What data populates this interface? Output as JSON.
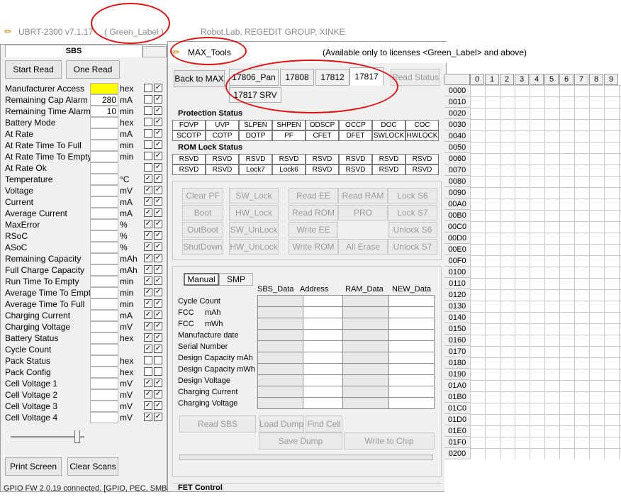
{
  "app": {
    "title": "UBRT-2300 v7.1.17",
    "label": "( Green_Label )",
    "org": "Robot.Lab,  REGEDIT GROUP,  XINKE"
  },
  "sbs": {
    "tab_label": "SBS",
    "start_read": "Start Read",
    "one_read": "One Read",
    "rows": [
      {
        "label": "Manufacturer Access",
        "value": "",
        "unit": "hex",
        "c1": "",
        "c2": "✓",
        "yellow": true
      },
      {
        "label": "Remaining Cap Alarm",
        "value": "280",
        "unit": "mA",
        "c1": "",
        "c2": "✓"
      },
      {
        "label": "Remaining Time Alarm",
        "value": "10",
        "unit": "min",
        "c1": "",
        "c2": "✓"
      },
      {
        "label": "Battery Mode",
        "value": "",
        "unit": "hex",
        "c1": "",
        "c2": "✓"
      },
      {
        "label": "At Rate",
        "value": "",
        "unit": "mA",
        "c1": "",
        "c2": "✓"
      },
      {
        "label": "At Rate Time To Full",
        "value": "",
        "unit": "min",
        "c1": "",
        "c2": "✓"
      },
      {
        "label": "At Rate Time To Empty",
        "value": "",
        "unit": "min",
        "c1": "",
        "c2": "✓"
      },
      {
        "label": "At Rate Ok",
        "value": "",
        "unit": "",
        "c1": "",
        "c2": "✓"
      },
      {
        "label": "Temperature",
        "value": "",
        "unit": "°C",
        "c1": "✓",
        "c2": "✓"
      },
      {
        "label": "Voltage",
        "value": "",
        "unit": "mV",
        "c1": "✓",
        "c2": "✓"
      },
      {
        "label": "Current",
        "value": "",
        "unit": "mA",
        "c1": "✓",
        "c2": "✓"
      },
      {
        "label": "Average Current",
        "value": "",
        "unit": "mA",
        "c1": "✓",
        "c2": "✓"
      },
      {
        "label": "MaxError",
        "value": "",
        "unit": "%",
        "c1": "✓",
        "c2": "✓"
      },
      {
        "label": "RSoC",
        "value": "",
        "unit": "%",
        "c1": "✓",
        "c2": "✓"
      },
      {
        "label": "ASoC",
        "value": "",
        "unit": "%",
        "c1": "✓",
        "c2": "✓"
      },
      {
        "label": "Remaining Capacity",
        "value": "",
        "unit": "mAh",
        "c1": "✓",
        "c2": "✓"
      },
      {
        "label": "Full Charge Capacity",
        "value": "",
        "unit": "mAh",
        "c1": "✓",
        "c2": "✓"
      },
      {
        "label": "Run Time To Empty",
        "value": "",
        "unit": "min",
        "c1": "✓",
        "c2": "✓"
      },
      {
        "label": "Average Time To Empty",
        "value": "",
        "unit": "min",
        "c1": "✓",
        "c2": "✓"
      },
      {
        "label": "Average Time To Full",
        "value": "",
        "unit": "min",
        "c1": "✓",
        "c2": "✓"
      },
      {
        "label": "Charging Current",
        "value": "",
        "unit": "mA",
        "c1": "✓",
        "c2": "✓"
      },
      {
        "label": "Charging Voltage",
        "value": "",
        "unit": "mV",
        "c1": "✓",
        "c2": "✓"
      },
      {
        "label": "Battery Status",
        "value": "",
        "unit": "hex",
        "c1": "✓",
        "c2": "✓"
      },
      {
        "label": "Cycle Count",
        "value": "",
        "unit": "",
        "c1": "✓",
        "c2": "✓"
      },
      {
        "label": "Pack Status",
        "value": "",
        "unit": "hex",
        "c1": "",
        "c2": ""
      },
      {
        "label": "Pack Config",
        "value": "",
        "unit": "hex",
        "c1": "",
        "c2": ""
      },
      {
        "label": "Cell Voltage 1",
        "value": "",
        "unit": "mV",
        "c1": "✓",
        "c2": "✓"
      },
      {
        "label": "Cell Voltage 2",
        "value": "",
        "unit": "mV",
        "c1": "✓",
        "c2": "✓"
      },
      {
        "label": "Cell Voltage 3",
        "value": "",
        "unit": "mV",
        "c1": "✓",
        "c2": "✓"
      },
      {
        "label": "Cell Voltage 4",
        "value": "",
        "unit": "mV",
        "c1": "✓",
        "c2": "✓"
      }
    ],
    "print_screen": "Print Screen",
    "clear_scans": "Clear Scans",
    "status_bar": "GPIO FW 2.0.19 connected. [GPIO, PEC, SMB"
  },
  "max": {
    "title": "MAX_Tools",
    "notice": "(Available only to licenses <Green_Label> and above)",
    "back_button": "Back to MAX",
    "tabs": [
      "17806_Pan",
      "17808",
      "17812",
      "17817",
      "17817 SRV"
    ],
    "active_tab": "17817",
    "read_status": "Read Status",
    "protection_title": "Protection Status",
    "protection": [
      [
        "FOVP",
        "UVP",
        "SLPEN",
        "SHPEN",
        "ODSCP",
        "OCCP",
        "DOC",
        "COC"
      ],
      [
        "SCOTP",
        "COTP",
        "DOTP",
        "PF",
        "CFET",
        "DFET",
        "SWLOCK",
        "HWLOCK"
      ]
    ],
    "rom_lock_title": "ROM Lock Status",
    "rom_lock": [
      [
        "RSVD",
        "RSVD",
        "RSVD",
        "RSVD",
        "RSVD",
        "RSVD",
        "RSVD",
        "RSVD"
      ],
      [
        "RSVD",
        "RSVD",
        "Lock7",
        "Lock6",
        "RSVD",
        "RSVD",
        "RSVD",
        "RSVD"
      ]
    ],
    "actions": [
      [
        "Clear PF",
        "SW_Lock",
        "Read EE",
        "Read RAM",
        "Lock S6"
      ],
      [
        "Boot",
        "HW_Lock",
        "Read ROM",
        "PRO",
        "Lock S7"
      ],
      [
        "OutBoot",
        "SW_UnLock",
        "Write EE",
        "",
        "Unlock S6"
      ],
      [
        "ShutDown",
        "HW_UnLock",
        "Write ROM",
        "All Erase",
        "Unlock S7"
      ]
    ],
    "subtabs": [
      "Manual",
      "SMP"
    ],
    "col_headers": [
      "SBS_Data",
      "Address",
      "RAM_Data",
      "NEW_Data"
    ],
    "param_rows": [
      "Cycle Count",
      "FCC     mAh",
      "FCC     mWh",
      "Manufacture date",
      "Serial Number",
      "Design Capacity mAh",
      "Design Capacity mWh",
      "Design Voltage",
      "Charging Current",
      "Charging Voltage"
    ],
    "read_sbs": "Read   SBS",
    "load_dump": "Load Dump",
    "find_cell": "Find Cell",
    "save_dump": "Save   Dump",
    "write_chip": "Write to Chip",
    "fet_control": "FET Control"
  },
  "hex": {
    "columns": [
      "0",
      "1",
      "2",
      "3",
      "4",
      "5",
      "6",
      "7",
      "8",
      "9"
    ],
    "rows": [
      "0000",
      "0010",
      "0020",
      "0030",
      "0040",
      "0050",
      "0060",
      "0070",
      "0080",
      "0090",
      "00A0",
      "00B0",
      "00C0",
      "00D0",
      "00E0",
      "00F0",
      "0100",
      "0110",
      "0120",
      "0130",
      "0140",
      "0150",
      "0160",
      "0170",
      "0180",
      "0190",
      "01A0",
      "01B0",
      "01C0",
      "01D0",
      "01E0",
      "01F0",
      "0200"
    ]
  },
  "colors": {
    "highlight": "#ffff00",
    "annotation": "#e01010"
  }
}
